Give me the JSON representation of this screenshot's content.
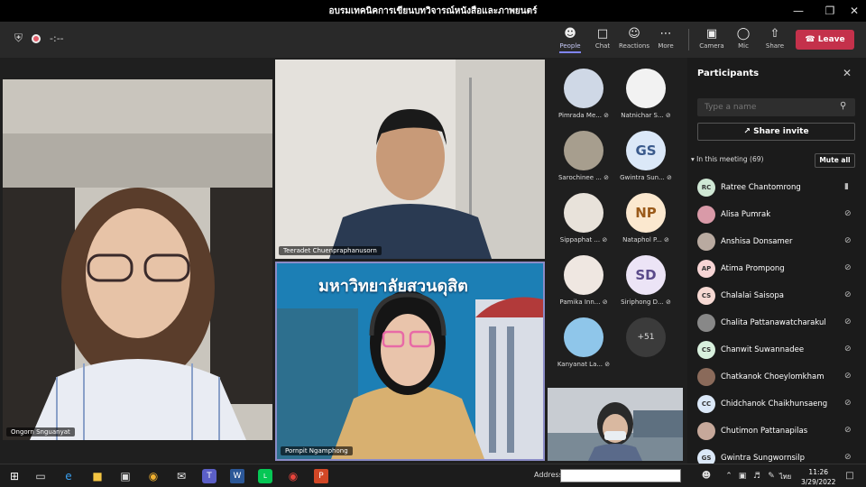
{
  "window": {
    "title": "อบรมเทคนิคการเขียนบทวิจารณ์หนังสือและภาพยนตร์"
  },
  "toolbar": {
    "timer": "-:--",
    "buttons": [
      {
        "label": "People",
        "icon": "people-icon"
      },
      {
        "label": "Chat",
        "icon": "chat-icon"
      },
      {
        "label": "Reactions",
        "icon": "reactions-icon"
      },
      {
        "label": "More",
        "icon": "more-icon"
      },
      {
        "label": "Camera",
        "icon": "camera-icon"
      },
      {
        "label": "Mic",
        "icon": "mic-icon"
      },
      {
        "label": "Share",
        "icon": "share-icon"
      }
    ],
    "leave": "Leave"
  },
  "stage": {
    "tiles": [
      {
        "name": "Ongorn Snguanyat"
      },
      {
        "name": "Teeradet Chuenpraphanusorn"
      },
      {
        "name": "Pornpit Ngamphong"
      }
    ],
    "banner_text": "มหาวิทยาลัยสวนดุสิต",
    "grid": [
      {
        "name": "Pimrada Me...",
        "initials": "",
        "color": "#cfd8e6"
      },
      {
        "name": "Natnichar S...",
        "initials": "",
        "color": "#f2f2f2"
      },
      {
        "name": "Sarochinee ...",
        "initials": "",
        "color": "#a79e8e"
      },
      {
        "name": "Gwintra Sun...",
        "initials": "GS",
        "color": "#dbe8f8"
      },
      {
        "name": "Sippaphat ...",
        "initials": "",
        "color": "#e8e2da"
      },
      {
        "name": "Nataphol P...",
        "initials": "NP",
        "color": "#fbe8cf"
      },
      {
        "name": "Pamika Inn...",
        "initials": "",
        "color": "#efe7e1"
      },
      {
        "name": "Siriphong D...",
        "initials": "SD",
        "color": "#ece4f6"
      },
      {
        "name": "Kanyanat La...",
        "initials": "",
        "color": "#8fc6ea"
      },
      {
        "name": "",
        "initials": "+51",
        "color": "#3b3b3b"
      }
    ]
  },
  "panel": {
    "title": "Participants",
    "search_placeholder": "Type a name",
    "share_invite": "Share invite",
    "in_meeting": "In this meeting (69)",
    "mute_all": "Mute all",
    "participants": [
      {
        "name": "Ratree Chantomrong",
        "initials": "RC",
        "color": "#cfe7d4",
        "mic": "on"
      },
      {
        "name": "Alisa Pumrak",
        "initials": "",
        "color": "#d99aa8",
        "mic": "off"
      },
      {
        "name": "Anshisa Donsamer",
        "initials": "",
        "color": "#b9aaa0",
        "mic": "off"
      },
      {
        "name": "Atima Prompong",
        "initials": "AP",
        "color": "#f7d5d5",
        "mic": "off"
      },
      {
        "name": "Chalalai Saisopa",
        "initials": "CS",
        "color": "#f6d9d3",
        "mic": "off"
      },
      {
        "name": "Chalita Pattanawatcharakul",
        "initials": "",
        "color": "#888",
        "mic": "off"
      },
      {
        "name": "Chanwit Suwannadee",
        "initials": "CS",
        "color": "#d8f0dd",
        "mic": "off"
      },
      {
        "name": "Chatkanok Choeylomkham",
        "initials": "",
        "color": "#8a6a5a",
        "mic": "off"
      },
      {
        "name": "Chidchanok Chaikhunsaeng",
        "initials": "CC",
        "color": "#dbe8f8",
        "mic": "off"
      },
      {
        "name": "Chutimon Pattanapilas",
        "initials": "",
        "color": "#c6a89a",
        "mic": "off"
      },
      {
        "name": "Gwintra Sungwornsilp",
        "initials": "GS",
        "color": "#dbe8f8",
        "mic": "off"
      }
    ]
  },
  "taskbar": {
    "address_label": "Address",
    "ime": "ไทย",
    "time": "11:26",
    "date": "3/29/2022"
  }
}
